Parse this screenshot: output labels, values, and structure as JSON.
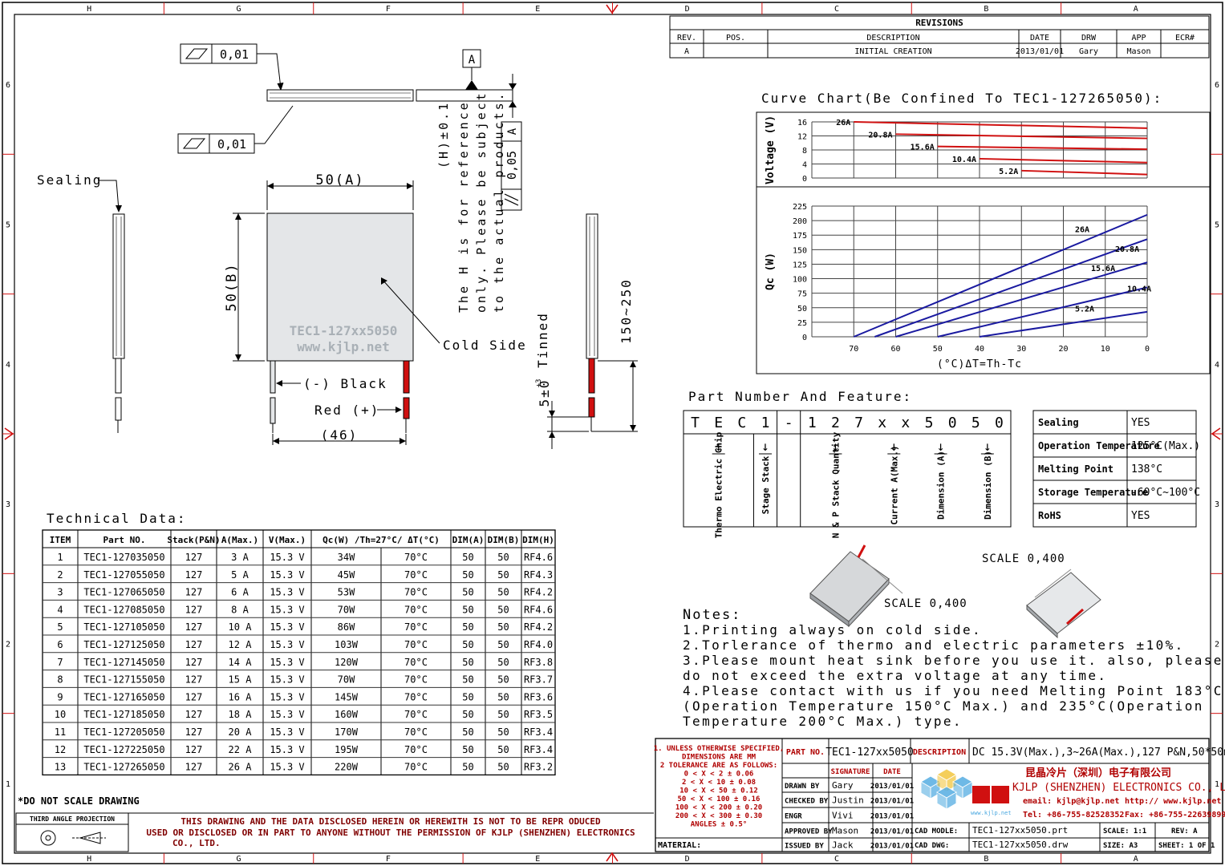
{
  "border": {
    "columns": [
      "H",
      "G",
      "F",
      "E",
      "D",
      "C",
      "B",
      "A"
    ],
    "rows": [
      "6",
      "5",
      "4",
      "3",
      "2",
      "1"
    ]
  },
  "revisions": {
    "title": "REVISIONS",
    "headers": [
      "REV.",
      "POS.",
      "DESCRIPTION",
      "DATE",
      "DRW",
      "APP",
      "ECR#"
    ],
    "rows": [
      [
        "A",
        "",
        "INITIAL CREATION",
        "2013/01/01",
        "Gary",
        "Mason",
        ""
      ]
    ]
  },
  "tolerances": {
    "flatness_top": "0,01",
    "flatness_bottom": "0,01",
    "datum": "A",
    "parallel_value": "0,05",
    "parallel_datum": "A"
  },
  "drawing": {
    "sealing_label": "Sealing",
    "width_dim": "50(A)",
    "height_dim": "50(B)",
    "watermark_1": "TEC1-127xx5050",
    "watermark_2": "www.kjlp.net",
    "cold_side": "Cold Side",
    "black_lead": "(-) Black",
    "red_lead": "Red (+)",
    "lead_spacing": "(46)",
    "h_note_1": "(H)±0.1",
    "h_note_2": "The H is for reference",
    "h_note_3": "only. Please be subject",
    "h_note_4": "to the actual products.",
    "tinned": "Tinned",
    "tin_len": "5±0",
    "tin_sup": "+3",
    "lead_len": "150~250"
  },
  "curve_chart": {
    "title": "Curve Chart(Be Confined To TEC1-127265050):"
  },
  "chart_data": [
    {
      "type": "line",
      "title": "",
      "ylabel": "Voltage (V)",
      "xlabel": "",
      "y_ticks": [
        "16",
        "12",
        "8",
        "4",
        "0"
      ],
      "ylim": [
        0,
        16
      ],
      "xlim": [
        80,
        0
      ],
      "grid": true,
      "series": [
        {
          "name": "26A",
          "x": [
            70,
            0
          ],
          "y": [
            16.0,
            14.2
          ]
        },
        {
          "name": "20.8A",
          "x": [
            60,
            0
          ],
          "y": [
            12.5,
            11.3
          ]
        },
        {
          "name": "15.6A",
          "x": [
            50,
            0
          ],
          "y": [
            9.0,
            8.2
          ]
        },
        {
          "name": "10.4A",
          "x": [
            40,
            0
          ],
          "y": [
            5.5,
            4.4
          ]
        },
        {
          "name": "5.2A",
          "x": [
            30,
            0
          ],
          "y": [
            2.1,
            1.0
          ]
        }
      ]
    },
    {
      "type": "line",
      "title": "",
      "ylabel": "Qc (W)",
      "xlabel": "(°C)ΔT=Th-Tc",
      "x_ticks": [
        "70",
        "60",
        "50",
        "40",
        "30",
        "20",
        "10",
        "0"
      ],
      "y_ticks": [
        "225",
        "200",
        "175",
        "150",
        "125",
        "100",
        "75",
        "50",
        "25",
        "0"
      ],
      "ylim": [
        0,
        225
      ],
      "xlim": [
        80,
        0
      ],
      "grid": true,
      "series": [
        {
          "name": "26A",
          "x": [
            70,
            0
          ],
          "y": [
            0,
            210
          ]
        },
        {
          "name": "20.8A",
          "x": [
            65,
            0
          ],
          "y": [
            0,
            168
          ]
        },
        {
          "name": "15.6A",
          "x": [
            60,
            0
          ],
          "y": [
            0,
            128
          ]
        },
        {
          "name": "10.4A",
          "x": [
            50,
            0
          ],
          "y": [
            0,
            85
          ]
        },
        {
          "name": "5.2A",
          "x": [
            40,
            0
          ],
          "y": [
            0,
            43
          ]
        }
      ]
    }
  ],
  "part_number": {
    "title": "Part Number And Feature:",
    "chars": [
      "T",
      "E",
      "C",
      "1",
      "-",
      "1",
      "2",
      "7",
      "x",
      "x",
      "5",
      "0",
      "5",
      "0"
    ],
    "arrow": "↓",
    "captions": [
      "Thermo Electric Chip",
      "Stage Stack",
      "N & P Stack Quantity",
      "Current A(Max.)",
      "Dimension (A)",
      "Dimension (B)"
    ]
  },
  "features": [
    {
      "label": "Sealing",
      "value": "YES"
    },
    {
      "label": "Operation Temperature",
      "value": "125°C(Max.)"
    },
    {
      "label": "Melting Point",
      "value": "138°C"
    },
    {
      "label": "Storage Temperature",
      "value": "-60°C~100°C"
    },
    {
      "label": "RoHS",
      "value": "YES"
    }
  ],
  "technical": {
    "title": "Technical Data:",
    "headers": [
      "ITEM",
      "Part NO.",
      "Stack(P&N)",
      "A(Max.)",
      "V(Max.)",
      "Qc(W) /Th=27°C/ ΔT(°C)",
      "DIM(A)",
      "DIM(B)",
      "DIM(H)"
    ],
    "rows": [
      [
        "1",
        "TEC1-127035050",
        "127",
        "3 A",
        "15.3 V",
        "34W",
        "70°C",
        "50",
        "50",
        "RF4.6"
      ],
      [
        "2",
        "TEC1-127055050",
        "127",
        "5 A",
        "15.3 V",
        "45W",
        "70°C",
        "50",
        "50",
        "RF4.3"
      ],
      [
        "3",
        "TEC1-127065050",
        "127",
        "6 A",
        "15.3 V",
        "53W",
        "70°C",
        "50",
        "50",
        "RF4.2"
      ],
      [
        "4",
        "TEC1-127085050",
        "127",
        "8 A",
        "15.3 V",
        "70W",
        "70°C",
        "50",
        "50",
        "RF4.6"
      ],
      [
        "5",
        "TEC1-127105050",
        "127",
        "10 A",
        "15.3 V",
        "86W",
        "70°C",
        "50",
        "50",
        "RF4.2"
      ],
      [
        "6",
        "TEC1-127125050",
        "127",
        "12 A",
        "15.3 V",
        "103W",
        "70°C",
        "50",
        "50",
        "RF4.0"
      ],
      [
        "7",
        "TEC1-127145050",
        "127",
        "14 A",
        "15.3 V",
        "120W",
        "70°C",
        "50",
        "50",
        "RF3.8"
      ],
      [
        "8",
        "TEC1-127155050",
        "127",
        "15 A",
        "15.3 V",
        "70W",
        "70°C",
        "50",
        "50",
        "RF3.7"
      ],
      [
        "9",
        "TEC1-127165050",
        "127",
        "16 A",
        "15.3 V",
        "145W",
        "70°C",
        "50",
        "50",
        "RF3.6"
      ],
      [
        "10",
        "TEC1-127185050",
        "127",
        "18 A",
        "15.3 V",
        "160W",
        "70°C",
        "50",
        "50",
        "RF3.5"
      ],
      [
        "11",
        "TEC1-127205050",
        "127",
        "20 A",
        "15.3 V",
        "170W",
        "70°C",
        "50",
        "50",
        "RF3.4"
      ],
      [
        "12",
        "TEC1-127225050",
        "127",
        "22 A",
        "15.3 V",
        "195W",
        "70°C",
        "50",
        "50",
        "RF3.4"
      ],
      [
        "13",
        "TEC1-127265050",
        "127",
        "26 A",
        "15.3 V",
        "220W",
        "70°C",
        "50",
        "50",
        "RF3.2"
      ]
    ]
  },
  "scales": {
    "scale_1": "SCALE 0,400",
    "scale_2": "SCALE 0,400"
  },
  "notes": {
    "title": "Notes:",
    "lines": [
      "1.Printing always on cold side.",
      "2.Torlerance of thermo and electric parameters ±10%.",
      "3.Please mount heat sink before you use it. also, please",
      "  do not exceed the extra voltage at any time.",
      "4.Please contact with us if you need Melting Point 183°C",
      "  (Operation Temperature 150°C Max.) and 235°C(Operation",
      "  Temperature 200°C Max.) type."
    ]
  },
  "footer": {
    "do_not_scale": "*DO NOT SCALE DRAWING",
    "projection": "THIRD ANGLE PROJECTION",
    "disclaimer_1": "THIS DRAWING AND THE DATA DISCLOSED HEREIN OR HEREWITH IS NOT TO BE REPR ODUCED",
    "disclaimer_2": "USED OR DISCLOSED OR IN PART TO ANYONE WITHOUT THE PERMISSION OF KJLP (SHENZHEN) ELECTRONICS",
    "disclaimer_3": "CO., LTD.",
    "tolerance_lines": [
      "1. UNLESS OTHERWISE SPECIFIED,",
      "DIMENSIONS ARE MM",
      "2 TOLERANCE ARE AS FOLLOWS:",
      "0 < X < 2 ± 0.06",
      "2 < X < 10 ± 0.08",
      "10 < X < 50 ± 0.12",
      "50 < X < 100 ± 0.16",
      "100 < X < 200 ± 0.20",
      "200 < X < 300 ± 0.30",
      "ANGLES ± 0.5°"
    ],
    "material_label": "MATERIAL:",
    "part_no_label": "PART NO.",
    "part_no_value": "TEC1-127xx5050",
    "description_label": "DESCRIPTION",
    "description_value": "DC 15.3V(Max.),3~26A(Max.),127 P&N,50*50mm",
    "signature_label": "SIGNATURE",
    "date_label": "DATE",
    "signatures": [
      {
        "role": "DRAWN BY",
        "name": "Gary",
        "date": "2013/01/01"
      },
      {
        "role": "CHECKED BY",
        "name": "Justin",
        "date": "2013/01/01"
      },
      {
        "role": "ENGR",
        "name": "Vivi",
        "date": "2013/01/01"
      },
      {
        "role": "APPROVED BY",
        "name": "Mason",
        "date": "2013/01/01"
      },
      {
        "role": "ISSUED BY",
        "name": "Jack",
        "date": "2013/01/01"
      }
    ],
    "company_cn": "昆晶冷片（深圳）电子有限公司",
    "company_en": "KJLP (SHENZHEN) ELECTRONICS CO., LTD",
    "email": "email: kjlp@kjlp.net",
    "web": "http:// www.kjlp.net",
    "tel": "Tel: +86-755-82528352",
    "fax": "Fax: +86-755-22639899",
    "cad_model_label": "CAD MODLE:",
    "cad_model_value": "TEC1-127xx5050.prt",
    "cad_dwg_label": "CAD DWG:",
    "cad_dwg_value": "TEC1-127xx5050.drw",
    "scale_label": "SCALE: 1:1",
    "rev_label": "REV: A",
    "size_label": "SIZE: A3",
    "sheet_label": "SHEET: 1 OF 1",
    "logo_text": "www.kjlp.net"
  },
  "colors": {
    "red_curve": "#d01010",
    "blue_curve": "#1a1aa0",
    "border_red": "#d01010",
    "module_fill": "#e4e6e8"
  }
}
